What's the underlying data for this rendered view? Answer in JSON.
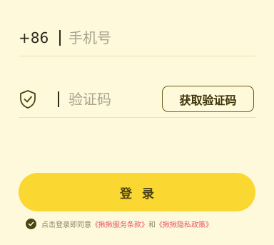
{
  "phone": {
    "country_code": "+86",
    "placeholder": "手机号",
    "value": ""
  },
  "code": {
    "placeholder": "验证码",
    "value": "",
    "get_code_label": "获取验证码"
  },
  "login": {
    "label": "登录"
  },
  "agreement": {
    "checked": true,
    "prefix": "点击登录即同意",
    "terms_link": "《揪揪服务条款》",
    "and": "和",
    "privacy_link": "《揪揪隐私政策》"
  },
  "colors": {
    "background": "#fdf9da",
    "accent_yellow": "#fbd731",
    "link_pink": "#e8546c",
    "dark_text": "#2d2a1e"
  },
  "icons": {
    "shield": "shield-check-icon",
    "check": "check-circle-icon"
  }
}
